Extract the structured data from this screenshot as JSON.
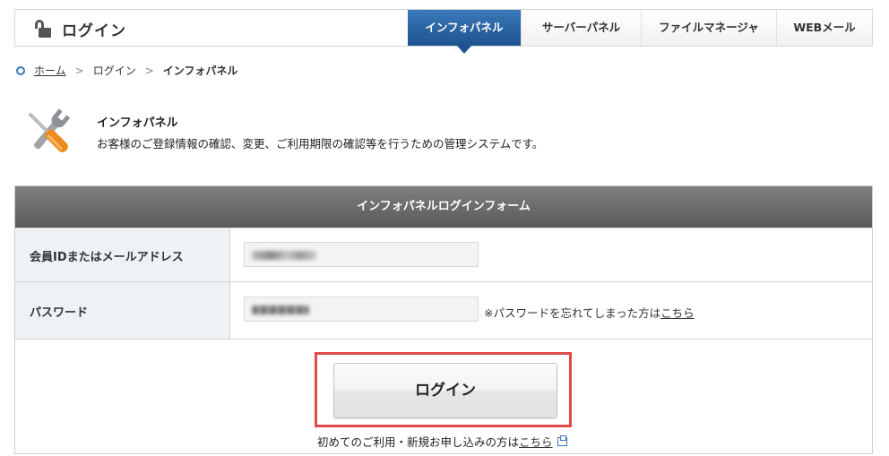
{
  "header": {
    "title": "ログイン",
    "tabs": [
      {
        "label": "インフォパネル",
        "active": true
      },
      {
        "label": "サーバーパネル",
        "active": false
      },
      {
        "label": "ファイルマネージャ",
        "active": false
      },
      {
        "label": "WEBメール",
        "active": false
      }
    ]
  },
  "breadcrumb": {
    "home": "ホーム",
    "login": "ログイン",
    "current": "インフォパネル"
  },
  "intro": {
    "title": "インフォパネル",
    "description": "お客様のご登録情報の確認、変更、ご利用期限の確認等を行うための管理システムです。"
  },
  "form": {
    "header": "インフォパネルログインフォーム",
    "member_label": "会員IDまたはメールアドレス",
    "password_label": "パスワード",
    "forgot_prefix": "※パスワードを忘れてしまった方は",
    "forgot_link": "こちら",
    "login_button": "ログイン",
    "new_prefix": "初めてのご利用・新規お申し込みの方は",
    "new_link": "こちら"
  },
  "colors": {
    "active_tab": "#2a66a8",
    "highlight": "#e04a4a",
    "form_header": "#6b6b6b"
  }
}
